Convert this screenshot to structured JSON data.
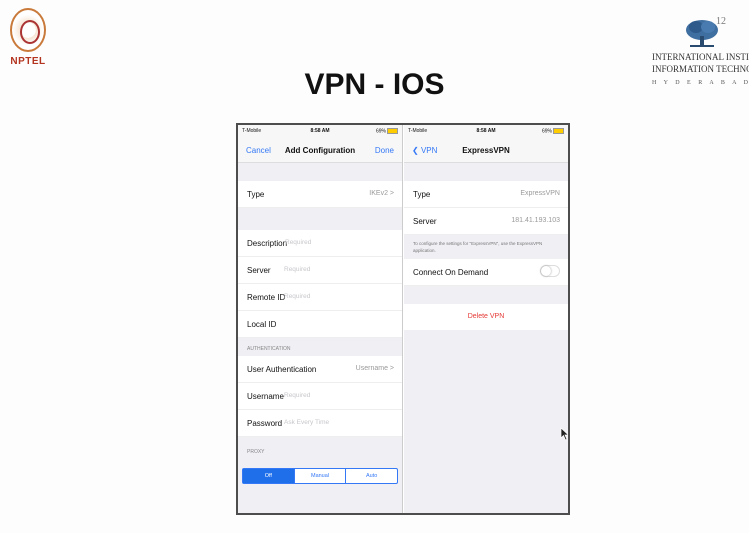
{
  "branding": {
    "nptel_text": "NPTEL",
    "page_number": "12",
    "institute_line1": "INTERNATIONAL INSTITUTE",
    "institute_line2": "INFORMATION TECHNOLO",
    "institute_city": "H Y D E R A B A D"
  },
  "slide": {
    "title": "VPN - IOS"
  },
  "left_screen": {
    "status": {
      "carrier": "T-Mobile",
      "time": "8:58 AM",
      "battery": "69%"
    },
    "nav": {
      "cancel": "Cancel",
      "title": "Add Configuration",
      "done": "Done"
    },
    "type": {
      "label": "Type",
      "value": "IKEv2 >"
    },
    "fields": [
      {
        "label": "Description",
        "placeholder": "Required"
      },
      {
        "label": "Server",
        "placeholder": "Required"
      },
      {
        "label": "Remote ID",
        "placeholder": "Required"
      },
      {
        "label": "Local ID",
        "placeholder": ""
      }
    ],
    "auth_header": "AUTHENTICATION",
    "user_auth": {
      "label": "User Authentication",
      "value": "Username >"
    },
    "username": {
      "label": "Username",
      "placeholder": "Required"
    },
    "password": {
      "label": "Password",
      "placeholder": "Ask Every Time"
    },
    "proxy_header": "PROXY",
    "proxy_options": [
      "Off",
      "Manual",
      "Auto"
    ],
    "proxy_selected": "Off"
  },
  "right_screen": {
    "status": {
      "carrier": "T-Mobile",
      "time": "8:58 AM",
      "battery": "69%"
    },
    "nav": {
      "back": "VPN",
      "title": "ExpressVPN"
    },
    "type": {
      "label": "Type",
      "value": "ExpressVPN"
    },
    "server": {
      "label": "Server",
      "value": "181.41.193.103"
    },
    "note": "To configure the settings for \"ExpressVPN\", use the ExpressVPN application.",
    "connect_on_demand": {
      "label": "Connect On Demand",
      "on": false
    },
    "delete_label": "Delete VPN"
  },
  "colors": {
    "ios_blue": "#3478f6",
    "delete_red": "#e53935",
    "background": "#efeff4"
  }
}
